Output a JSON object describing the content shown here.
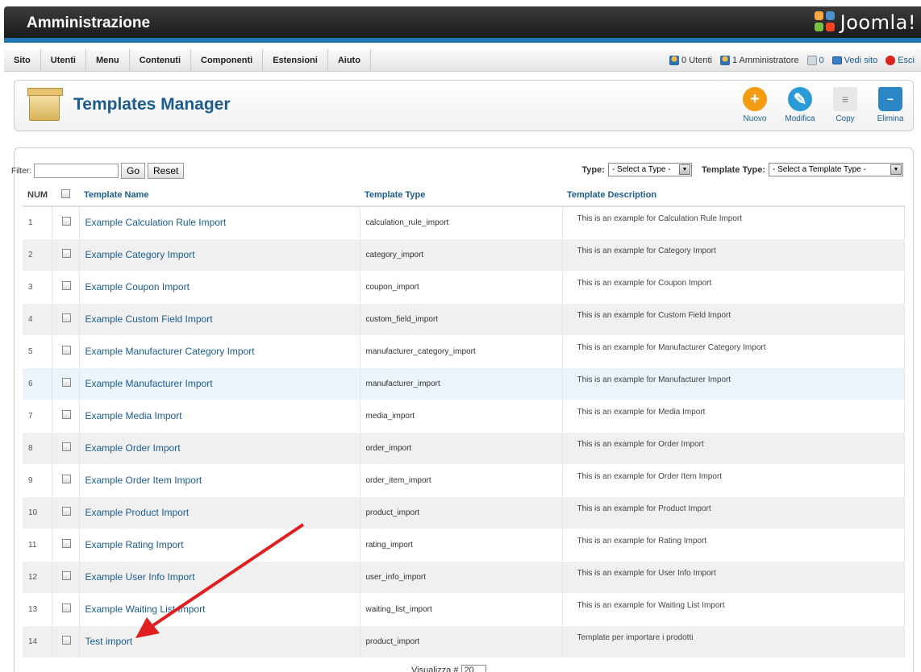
{
  "header": {
    "title": "Amministrazione",
    "logo_text": "Joomla!"
  },
  "menu": [
    "Sito",
    "Utenti",
    "Menu",
    "Contenuti",
    "Componenti",
    "Estensioni",
    "Aiuto"
  ],
  "status": {
    "users": "0 Utenti",
    "admins": "1 Amministratore",
    "messages": "0",
    "view_site": "Vedi sito",
    "logout": "Esci"
  },
  "toolbar": {
    "page_title": "Templates Manager",
    "buttons": [
      {
        "label": "Nuovo",
        "color": "#f39c12"
      },
      {
        "label": "Modifica",
        "color": "#2a9bd6"
      },
      {
        "label": "Copy",
        "color": "#d8d8d8"
      },
      {
        "label": "Elimina",
        "color": "#2a86c5"
      }
    ]
  },
  "filter": {
    "label": "Filter:",
    "value": "",
    "go": "Go",
    "reset": "Reset"
  },
  "type_filter": {
    "type_label": "Type:",
    "type_value": "- Select a Type -",
    "ttype_label": "Template Type:",
    "ttype_value": "- Select a Template Type -"
  },
  "table": {
    "headers": {
      "num": "NUM",
      "name": "Template Name",
      "type": "Template Type",
      "desc": "Template Description"
    },
    "rows": [
      {
        "num": "1",
        "name": "Example Calculation Rule Import",
        "type": "calculation_rule_import",
        "desc": "This is an example for Calculation Rule Import"
      },
      {
        "num": "2",
        "name": "Example Category Import",
        "type": "category_import",
        "desc": "This is an example for Category Import"
      },
      {
        "num": "3",
        "name": "Example Coupon Import",
        "type": "coupon_import",
        "desc": "This is an example for Coupon Import"
      },
      {
        "num": "4",
        "name": "Example Custom Field Import",
        "type": "custom_field_import",
        "desc": "This is an example for Custom Field Import"
      },
      {
        "num": "5",
        "name": "Example Manufacturer Category Import",
        "type": "manufacturer_category_import",
        "desc": "This is an example for Manufacturer Category Import"
      },
      {
        "num": "6",
        "name": "Example Manufacturer Import",
        "type": "manufacturer_import",
        "desc": "This is an example for Manufacturer Import"
      },
      {
        "num": "7",
        "name": "Example Media Import",
        "type": "media_import",
        "desc": "This is an example for Media Import"
      },
      {
        "num": "8",
        "name": "Example Order Import",
        "type": "order_import",
        "desc": "This is an example for Order Import"
      },
      {
        "num": "9",
        "name": "Example Order Item Import",
        "type": "order_item_import",
        "desc": "This is an example for Order Item Import"
      },
      {
        "num": "10",
        "name": "Example Product Import",
        "type": "product_import",
        "desc": "This is an example for Product Import"
      },
      {
        "num": "11",
        "name": "Example Rating Import",
        "type": "rating_import",
        "desc": "This is an example for Rating Import"
      },
      {
        "num": "12",
        "name": "Example User Info Import",
        "type": "user_info_import",
        "desc": "This is an example for User Info Import"
      },
      {
        "num": "13",
        "name": "Example Waiting List Import",
        "type": "waiting_list_import",
        "desc": "This is an example for Waiting List Import"
      },
      {
        "num": "14",
        "name": "Test import",
        "type": "product_import",
        "desc": "Template per importare i prodotti"
      }
    ]
  },
  "pager": {
    "label": "Visualizza #",
    "value": "20"
  },
  "colors": {
    "accent": "#1b5c8f",
    "header_bar": "#1f77b4",
    "arrow": "#e02020"
  }
}
